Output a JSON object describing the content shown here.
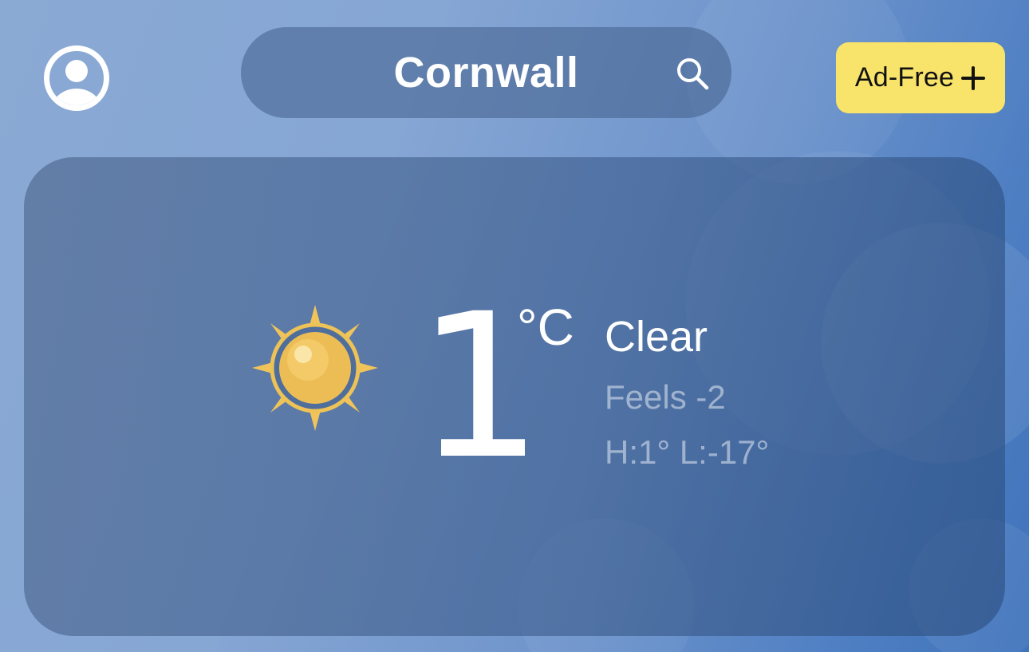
{
  "header": {
    "profile_icon": "person-circle-icon",
    "location": "Cornwall",
    "search_icon": "magnifier-icon",
    "adfree_label": "Ad-Free",
    "adfree_icon": "plus-icon",
    "adfree_color": "#f8e46a"
  },
  "current": {
    "condition_icon": "sun-icon",
    "temperature": "1",
    "unit": "°C",
    "condition": "Clear",
    "feels_like": "Feels -2",
    "high_low": "H:1° L:-17°"
  },
  "colors": {
    "sun_fill": "#f0c45a",
    "sun_ring": "#e9b84a",
    "card_background": "#4a6a98"
  }
}
